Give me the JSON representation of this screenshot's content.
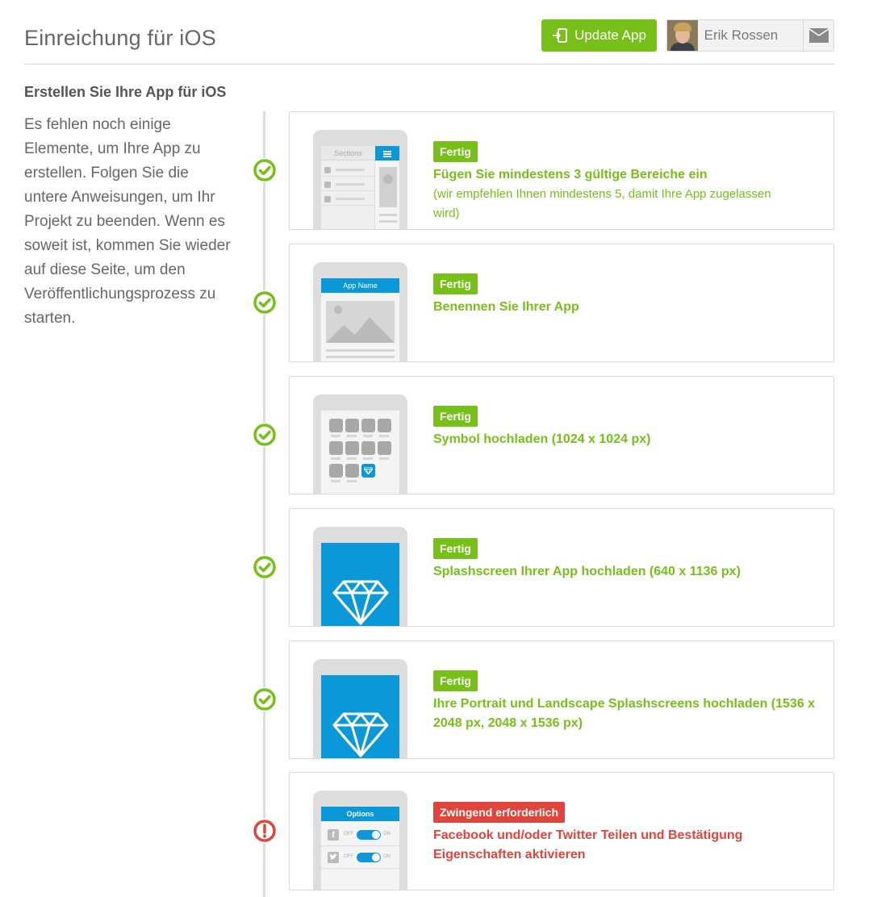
{
  "header": {
    "title": "Einreichung für iOS",
    "update_button_label": "Update App",
    "user_name": "Erik Rossen"
  },
  "section": {
    "title": "Erstellen Sie Ihre App für iOS",
    "intro": "Es fehlen noch einige Elemente, um Ihre App zu erstellen. Folgen Sie die untere Anweisungen, um Ihr Projekt zu beenden. Wenn es soweit ist, kommen Sie wieder auf diese Seite, um den Veröffentlichungsprozess zu starten."
  },
  "steps": [
    {
      "status": "Fertig",
      "state": "done",
      "title": "Fügen Sie mindestens 3 gültige Bereiche ein",
      "subtitle": "(wir empfehlen Ihnen mindestens 5, damit Ihre App zugelassen wird)",
      "mockup_label": "Sections"
    },
    {
      "status": "Fertig",
      "state": "done",
      "title": "Benennen Sie Ihrer App",
      "mockup_label": "App Name"
    },
    {
      "status": "Fertig",
      "state": "done",
      "title": "Symbol hochladen (1024 x 1024 px)"
    },
    {
      "status": "Fertig",
      "state": "done",
      "title": "Splashscreen Ihrer App hochladen (640 x 1136 px)"
    },
    {
      "status": "Fertig",
      "state": "done",
      "title": "Ihre Portrait und Landscape Splashscreens hochladen (1536 x 2048 px, 2048 x 1536 px)"
    },
    {
      "status": "Zwingend erforderlich",
      "state": "required",
      "title": "Facebook und/oder Twitter Teilen und Bestätigung Eigenschaften aktivieren",
      "mockup_label": "Options",
      "toggle_off": "OFF",
      "toggle_on": "ON"
    }
  ],
  "colors": {
    "success": "#77bf19",
    "error": "#e0453c",
    "accent_blue": "#0a98d9"
  }
}
